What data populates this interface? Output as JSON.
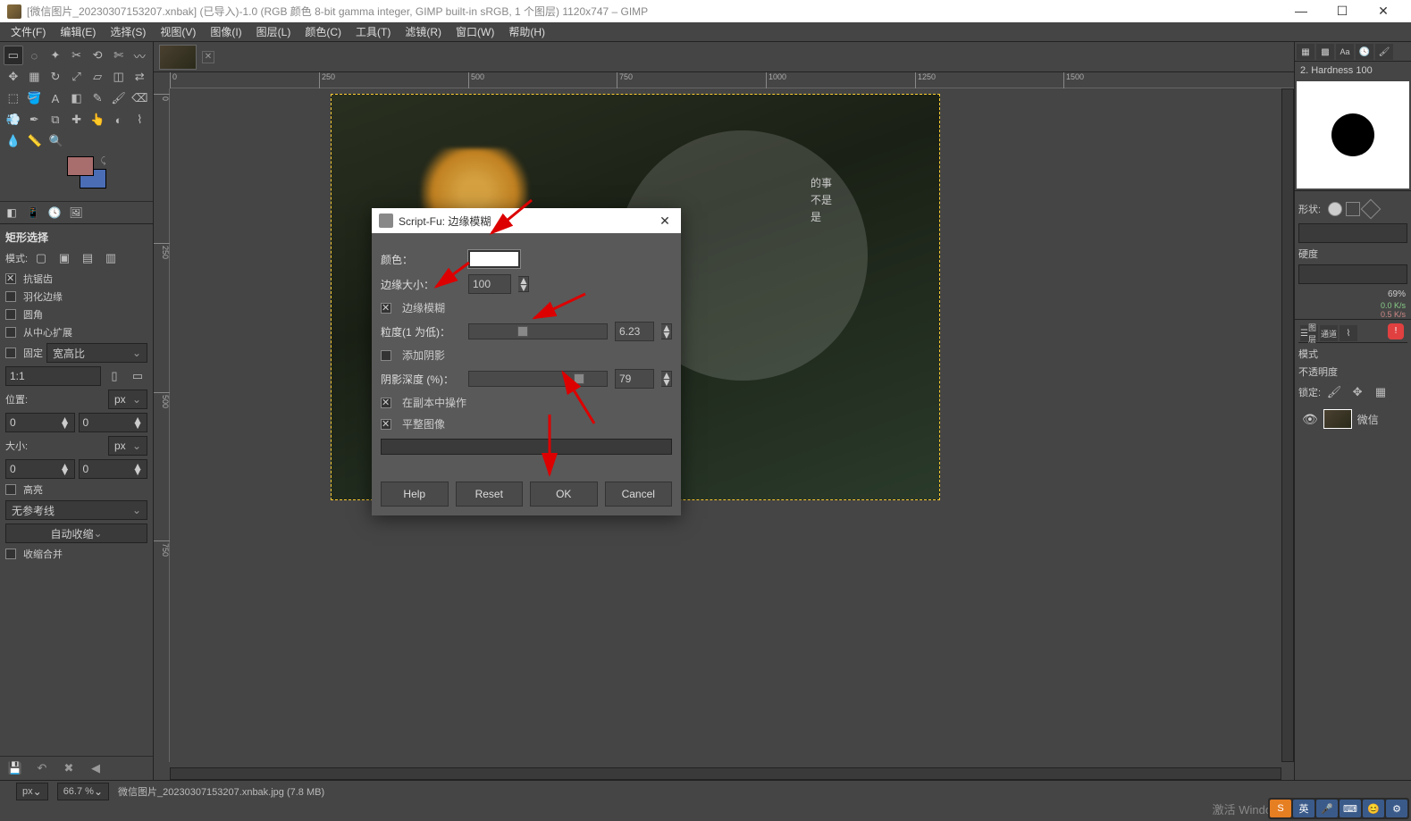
{
  "title": "[微信图片_20230307153207.xnbak] (已导入)-1.0 (RGB 颜色 8-bit gamma integer, GIMP built-in sRGB, 1 个图层) 1120x747 – GIMP",
  "menu": [
    "文件(F)",
    "编辑(E)",
    "选择(S)",
    "视图(V)",
    "图像(I)",
    "图层(L)",
    "颜色(C)",
    "工具(T)",
    "滤镜(R)",
    "窗口(W)",
    "帮助(H)"
  ],
  "toolopts": {
    "title": "矩形选择",
    "mode_label": "模式:",
    "antialias": "抗锯齿",
    "feather": "羽化边缘",
    "rounded": "圆角",
    "expand_center": "从中心扩展",
    "fixed": "固定",
    "fixed_val": "宽高比",
    "ratio": "1:1",
    "position": "位置:",
    "unit_px": "px",
    "pos_x": "0",
    "pos_y": "0",
    "size": "大小:",
    "size_x": "0",
    "size_y": "0",
    "highlight": "高亮",
    "guides": "无参考线",
    "autoshrink": "自动收缩",
    "shrink_merged": "收缩合并"
  },
  "ruler_h": [
    "0",
    "250",
    "500",
    "750",
    "1000",
    "1250",
    "1500"
  ],
  "ruler_v": [
    "0",
    "250",
    "500",
    "750"
  ],
  "image_text": [
    "的事",
    "不是",
    "是"
  ],
  "dialog": {
    "title": "Script-Fu: 边缘模糊",
    "color": "颜色：",
    "edge_size": "边缘大小：",
    "edge_size_val": "100",
    "edge_blur": "边缘模糊",
    "granularity": "粒度(1 为低)：",
    "granularity_val": "6.23",
    "add_shadow": "添加阴影",
    "shadow_depth": "阴影深度 (%)：",
    "shadow_depth_val": "79",
    "work_copy": "在副本中操作",
    "flatten": "平整图像",
    "help": "Help",
    "reset": "Reset",
    "ok": "OK",
    "cancel": "Cancel"
  },
  "right": {
    "brush_label": "2. Hardness 100",
    "shape_label": "形状:",
    "hardness": "硬度",
    "layers_tab": "图层",
    "channels_tab": "通道",
    "mode": "模式",
    "opacity": "不透明度",
    "lock": "锁定:",
    "layer_name": "微信",
    "pct69": "69%",
    "kis1": "0.0 K/s",
    "kis2": "0.5 K/s"
  },
  "status": {
    "unit": "px",
    "zoom": "66.7 %",
    "filename": "微信图片_20230307153207.xnbak.jpg (7.8 MB)"
  },
  "sys": {
    "activate": "激活 Windows",
    "ime": "英"
  }
}
